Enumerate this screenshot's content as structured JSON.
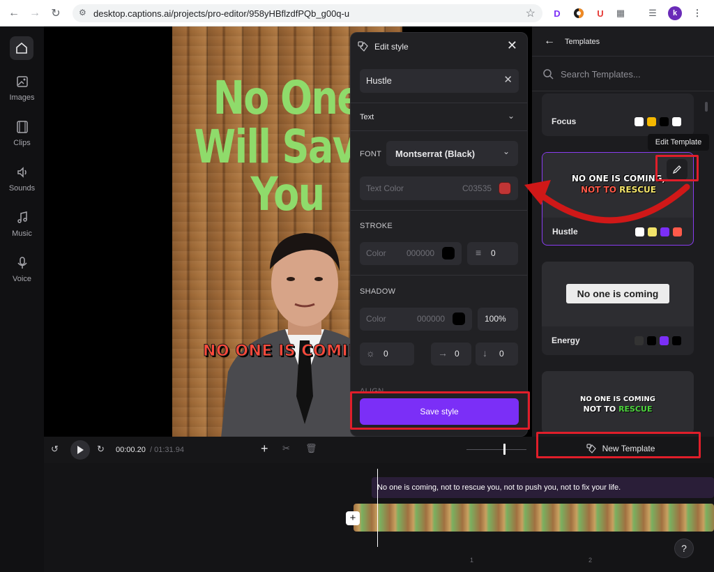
{
  "browser": {
    "url": "desktop.captions.ai/projects/pro-editor/958yHBflzdfPQb_g00q-u",
    "profile_initial": "k",
    "ext_d": "D",
    "ext_u": "U"
  },
  "rail": {
    "items": [
      {
        "label": "Images"
      },
      {
        "label": "Clips"
      },
      {
        "label": "Sounds"
      },
      {
        "label": "Music"
      },
      {
        "label": "Voice"
      }
    ]
  },
  "video": {
    "title_lines": [
      "No One",
      "Will Save",
      "You"
    ],
    "caption": "NO ONE IS COMING"
  },
  "edit_style": {
    "header": "Edit style",
    "style_name": "Hustle",
    "text_section": "Text",
    "font_label": "FONT",
    "font_value": "Montserrat (Black)",
    "text_color_label": "Text Color",
    "text_color_value": "C03535",
    "stroke_label": "STROKE",
    "stroke_color_label": "Color",
    "stroke_color_value": "000000",
    "stroke_width": "0",
    "shadow_label": "SHADOW",
    "shadow_color_label": "Color",
    "shadow_color_value": "000000",
    "shadow_opacity": "100%",
    "shadow_blur": "0",
    "shadow_x": "0",
    "shadow_y": "0",
    "align_label": "ALIGN",
    "save_label": "Save style",
    "colors": {
      "text": "#c03535",
      "stroke": "#000000",
      "shadow": "#000000",
      "accent": "#7b2ff7"
    }
  },
  "templates": {
    "header": "Templates",
    "search_placeholder": "Search Templates...",
    "tooltip": "Edit Template",
    "cards": [
      {
        "name": "Focus",
        "swatches": [
          "#ffffff",
          "#f5b800",
          "#000000",
          "#ffffff"
        ]
      },
      {
        "name": "Hustle",
        "preview_line1": "NO ONE IS COMING,",
        "preview_line2a": "NOT TO ",
        "preview_line2b": "RESCUE",
        "swatches": [
          "#ffffff",
          "#f2e36a",
          "#7b2ff7",
          "#ff5a4a"
        ]
      },
      {
        "name": "Energy",
        "preview": "No one is coming",
        "swatches": [
          "#333333",
          "#000000",
          "#7b2ff7",
          "#000000"
        ]
      },
      {
        "name": "",
        "preview_line1": "NO ONE IS COMING",
        "preview_line2a": "NOT TO ",
        "preview_line2b": "RESCUE"
      }
    ],
    "new_template_label": "New Template"
  },
  "transport": {
    "current_time": "00:00.20",
    "total_time": "/ 01:31.94"
  },
  "timeline": {
    "caption_track": "No one is coming, not to rescue you, not to push you, not to fix your life.",
    "ruler": [
      "1",
      "2"
    ],
    "help": "?"
  }
}
